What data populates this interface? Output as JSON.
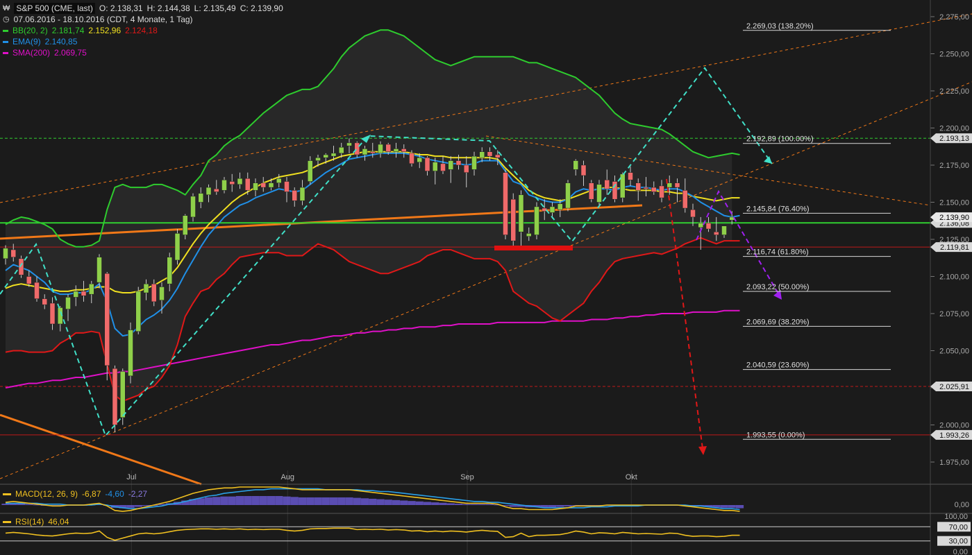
{
  "header": {
    "symbol": "S&P 500 (CME, last)",
    "open": "O: 2.138,31",
    "high": "H: 2.144,38",
    "low": "L: 2.135,49",
    "close": "C: 2.139,90",
    "range": "07.06.2016 - 18.10.2016 (CDT, 4 Monate, 1 Tag)"
  },
  "indicators": {
    "bb": {
      "label": "BB(20, 2)",
      "v1": "2.181,74",
      "v2": "2.152,96",
      "v3": "2.124,18"
    },
    "ema": {
      "label": "EMA(9)",
      "v": "2.140,85"
    },
    "sma": {
      "label": "SMA(200)",
      "v": "2.069,75"
    },
    "macd": {
      "label": "MACD(12, 26, 9)",
      "v1": "-6,87",
      "v2": "-4,60",
      "v3": "-2,27"
    },
    "rsi": {
      "label": "RSI(14)",
      "v": "46,04"
    }
  },
  "colors": {
    "background": "#1b1b1b",
    "bb_upper": "#2ecc2e",
    "bb_mid": "#f0e020",
    "bb_lower": "#e01818",
    "ema": "#2090e8",
    "sma": "#e010c8",
    "candle_up": "#8fd04a",
    "candle_down": "#f06a6a",
    "trend_orange": "#f07818",
    "zigzag_cyan": "#40e0c8",
    "arrow_purple": "#a020f0",
    "arrow_red": "#e01818"
  },
  "chart_data": {
    "type": "candlestick",
    "title": "S&P 500 (CME, last)",
    "ylim": [
      1955,
      2285
    ],
    "y_ticks": [
      "2.275,00",
      "2.250,00",
      "2.225,00",
      "2.200,00",
      "2.175,00",
      "2.150,00",
      "2.125,00",
      "2.100,00",
      "2.075,00",
      "2.050,00",
      "2.025,00",
      "2.000,00",
      "1.975,00"
    ],
    "x_labels": [
      {
        "label": "Jul",
        "index": 17
      },
      {
        "label": "Aug",
        "index": 37
      },
      {
        "label": "Sep",
        "index": 60
      },
      {
        "label": "Okt",
        "index": 81
      }
    ],
    "candles": [
      [
        2112,
        2121,
        2108,
        2119
      ],
      [
        2118,
        2122,
        2110,
        2113
      ],
      [
        2112,
        2114,
        2099,
        2101
      ],
      [
        2100,
        2104,
        2093,
        2095
      ],
      [
        2096,
        2100,
        2083,
        2085
      ],
      [
        2085,
        2088,
        2078,
        2081
      ],
      [
        2082,
        2086,
        2064,
        2068
      ],
      [
        2068,
        2080,
        2063,
        2079
      ],
      [
        2078,
        2088,
        2070,
        2086
      ],
      [
        2086,
        2094,
        2080,
        2090
      ],
      [
        2090,
        2097,
        2083,
        2087
      ],
      [
        2088,
        2097,
        2082,
        2095
      ],
      [
        2096,
        2115,
        2092,
        2113
      ],
      [
        2102,
        2103,
        2030,
        2040
      ],
      [
        2038,
        2040,
        1995,
        2000
      ],
      [
        2005,
        2038,
        2000,
        2036
      ],
      [
        2033,
        2069,
        2028,
        2064
      ],
      [
        2063,
        2093,
        2061,
        2090
      ],
      [
        2089,
        2098,
        2084,
        2095
      ],
      [
        2095,
        2098,
        2080,
        2083
      ],
      [
        2084,
        2096,
        2075,
        2093
      ],
      [
        2095,
        2116,
        2090,
        2113
      ],
      [
        2111,
        2132,
        2108,
        2129
      ],
      [
        2128,
        2142,
        2125,
        2141
      ],
      [
        2140,
        2156,
        2137,
        2154
      ],
      [
        2150,
        2160,
        2146,
        2156
      ],
      [
        2155,
        2162,
        2150,
        2160
      ],
      [
        2159,
        2165,
        2155,
        2157
      ],
      [
        2158,
        2167,
        2156,
        2165
      ],
      [
        2164,
        2169,
        2157,
        2162
      ],
      [
        2162,
        2170,
        2159,
        2166
      ],
      [
        2166,
        2170,
        2155,
        2158
      ],
      [
        2158,
        2166,
        2154,
        2163
      ],
      [
        2163,
        2167,
        2157,
        2160
      ],
      [
        2160,
        2166,
        2158,
        2163
      ],
      [
        2163,
        2169,
        2160,
        2166
      ],
      [
        2164,
        2167,
        2150,
        2157
      ],
      [
        2158,
        2160,
        2147,
        2151
      ],
      [
        2151,
        2165,
        2148,
        2160
      ],
      [
        2164,
        2181,
        2162,
        2178
      ],
      [
        2178,
        2182,
        2174,
        2180
      ],
      [
        2180,
        2183,
        2176,
        2182
      ],
      [
        2181,
        2188,
        2178,
        2183
      ],
      [
        2183,
        2190,
        2180,
        2187
      ],
      [
        2188,
        2193,
        2183,
        2190
      ],
      [
        2190,
        2191,
        2180,
        2182
      ],
      [
        2182,
        2188,
        2178,
        2186
      ],
      [
        2184,
        2190,
        2180,
        2183
      ],
      [
        2183,
        2191,
        2180,
        2189
      ],
      [
        2189,
        2190,
        2182,
        2184
      ],
      [
        2184,
        2190,
        2180,
        2186
      ],
      [
        2186,
        2189,
        2180,
        2184
      ],
      [
        2183,
        2185,
        2174,
        2176
      ],
      [
        2177,
        2183,
        2173,
        2180
      ],
      [
        2180,
        2181,
        2168,
        2171
      ],
      [
        2171,
        2180,
        2162,
        2177
      ],
      [
        2176,
        2181,
        2169,
        2171
      ],
      [
        2172,
        2181,
        2163,
        2178
      ],
      [
        2178,
        2182,
        2172,
        2175
      ],
      [
        2175,
        2181,
        2160,
        2170
      ],
      [
        2172,
        2184,
        2168,
        2181
      ],
      [
        2180,
        2187,
        2177,
        2184
      ],
      [
        2184,
        2187,
        2178,
        2181
      ],
      [
        2182,
        2185,
        2175,
        2180
      ],
      [
        2170,
        2172,
        2125,
        2128
      ],
      [
        2152,
        2156,
        2120,
        2124
      ],
      [
        2130,
        2158,
        2118,
        2155
      ],
      [
        2127,
        2133,
        2124,
        2129
      ],
      [
        2128,
        2150,
        2125,
        2147
      ],
      [
        2146,
        2152,
        2138,
        2144
      ],
      [
        2143,
        2150,
        2139,
        2147
      ],
      [
        2145,
        2152,
        2140,
        2149
      ],
      [
        2146,
        2165,
        2144,
        2163
      ],
      [
        2172,
        2179,
        2168,
        2178
      ],
      [
        2175,
        2178,
        2161,
        2168
      ],
      [
        2163,
        2165,
        2150,
        2152
      ],
      [
        2150,
        2165,
        2148,
        2162
      ],
      [
        2165,
        2172,
        2155,
        2159
      ],
      [
        2164,
        2168,
        2150,
        2152
      ],
      [
        2153,
        2170,
        2150,
        2169
      ],
      [
        2170,
        2174,
        2161,
        2165
      ],
      [
        2163,
        2166,
        2151,
        2158
      ],
      [
        2160,
        2167,
        2154,
        2159
      ],
      [
        2160,
        2164,
        2155,
        2157
      ],
      [
        2161,
        2165,
        2150,
        2153
      ],
      [
        2160,
        2168,
        2155,
        2163
      ],
      [
        2163,
        2166,
        2150,
        2160
      ],
      [
        2158,
        2166,
        2143,
        2146
      ],
      [
        2145,
        2149,
        2134,
        2140
      ],
      [
        2133,
        2140,
        2118,
        2136
      ],
      [
        2136,
        2140,
        2130,
        2132
      ],
      [
        2130,
        2140,
        2124,
        2128
      ],
      [
        2128,
        2133,
        2126,
        2134
      ],
      [
        2138,
        2144,
        2135,
        2140
      ]
    ],
    "bb_upper": [
      2135,
      2138,
      2140,
      2139,
      2137,
      2135,
      2132,
      2125,
      2122,
      2120,
      2120,
      2121,
      2124,
      2145,
      2160,
      2162,
      2160,
      2160,
      2160,
      2162,
      2162,
      2160,
      2158,
      2155,
      2162,
      2168,
      2178,
      2182,
      2188,
      2192,
      2195,
      2200,
      2205,
      2210,
      2214,
      2218,
      2222,
      2224,
      2226,
      2226,
      2228,
      2234,
      2240,
      2248,
      2254,
      2258,
      2262,
      2264,
      2266,
      2266,
      2264,
      2262,
      2258,
      2254,
      2250,
      2246,
      2244,
      2242,
      2244,
      2246,
      2248,
      2248,
      2248,
      2248,
      2248,
      2248,
      2246,
      2244,
      2244,
      2242,
      2240,
      2238,
      2236,
      2234,
      2230,
      2226,
      2222,
      2216,
      2210,
      2206,
      2203,
      2202,
      2201,
      2200,
      2199,
      2196,
      2192,
      2188,
      2184,
      2182,
      2180,
      2181,
      2182,
      2183,
      2182
    ],
    "bb_mid": [
      2092,
      2094,
      2095,
      2094,
      2093,
      2092,
      2091,
      2090,
      2090,
      2091,
      2091,
      2092,
      2093,
      2093,
      2090,
      2089,
      2089,
      2090,
      2092,
      2094,
      2097,
      2100,
      2106,
      2114,
      2122,
      2129,
      2135,
      2140,
      2145,
      2150,
      2154,
      2157,
      2160,
      2163,
      2165,
      2167,
      2168,
      2169,
      2170,
      2172,
      2175,
      2177,
      2179,
      2181,
      2182,
      2183,
      2184,
      2184,
      2184,
      2184,
      2184,
      2184,
      2183,
      2182,
      2182,
      2181,
      2181,
      2180,
      2180,
      2180,
      2180,
      2180,
      2180,
      2179,
      2173,
      2168,
      2163,
      2158,
      2155,
      2153,
      2152,
      2151,
      2152,
      2154,
      2156,
      2158,
      2159,
      2160,
      2160,
      2159,
      2158,
      2158,
      2158,
      2158,
      2157,
      2157,
      2156,
      2156,
      2154,
      2153,
      2152,
      2151,
      2152,
      2153,
      2153
    ],
    "bb_lower": [
      2049,
      2050,
      2050,
      2049,
      2049,
      2049,
      2050,
      2055,
      2058,
      2062,
      2062,
      2063,
      2062,
      2041,
      2020,
      2016,
      2018,
      2020,
      2024,
      2026,
      2032,
      2040,
      2054,
      2073,
      2082,
      2090,
      2092,
      2098,
      2102,
      2108,
      2113,
      2114,
      2115,
      2116,
      2116,
      2116,
      2114,
      2114,
      2114,
      2118,
      2122,
      2120,
      2118,
      2114,
      2110,
      2108,
      2106,
      2104,
      2102,
      2102,
      2104,
      2106,
      2108,
      2110,
      2114,
      2116,
      2118,
      2118,
      2116,
      2114,
      2112,
      2112,
      2112,
      2110,
      2104,
      2090,
      2086,
      2082,
      2080,
      2076,
      2072,
      2070,
      2074,
      2078,
      2082,
      2090,
      2096,
      2104,
      2110,
      2112,
      2113,
      2114,
      2115,
      2116,
      2115,
      2117,
      2119,
      2122,
      2124,
      2126,
      2124,
      2122,
      2124,
      2124,
      2124
    ],
    "ema": [
      2104,
      2108,
      2106,
      2104,
      2100,
      2096,
      2090,
      2088,
      2088,
      2089,
      2089,
      2091,
      2095,
      2083,
      2065,
      2060,
      2061,
      2066,
      2071,
      2074,
      2078,
      2084,
      2092,
      2102,
      2111,
      2120,
      2128,
      2134,
      2140,
      2144,
      2148,
      2150,
      2153,
      2155,
      2157,
      2159,
      2158,
      2157,
      2158,
      2162,
      2166,
      2170,
      2173,
      2176,
      2179,
      2180,
      2181,
      2182,
      2183,
      2183,
      2183,
      2183,
      2182,
      2181,
      2179,
      2178,
      2177,
      2176,
      2176,
      2175,
      2176,
      2178,
      2178,
      2178,
      2171,
      2164,
      2162,
      2155,
      2153,
      2151,
      2150,
      2150,
      2152,
      2157,
      2159,
      2158,
      2159,
      2159,
      2158,
      2160,
      2161,
      2160,
      2160,
      2159,
      2158,
      2159,
      2159,
      2157,
      2154,
      2150,
      2147,
      2144,
      2141,
      2140,
      2141
    ],
    "sma": [
      2025,
      2026,
      2027,
      2028,
      2028,
      2029,
      2030,
      2030,
      2031,
      2032,
      2032,
      2033,
      2034,
      2035,
      2035,
      2036,
      2036,
      2037,
      2038,
      2039,
      2040,
      2041,
      2042,
      2043,
      2044,
      2045,
      2046,
      2047,
      2048,
      2049,
      2050,
      2051,
      2052,
      2053,
      2054,
      2054,
      2055,
      2056,
      2057,
      2057,
      2058,
      2059,
      2060,
      2060,
      2061,
      2062,
      2062,
      2063,
      2063,
      2064,
      2064,
      2065,
      2065,
      2066,
      2066,
      2066,
      2067,
      2067,
      2068,
      2068,
      2068,
      2068,
      2068,
      2069,
      2069,
      2069,
      2069,
      2069,
      2069,
      2069,
      2070,
      2070,
      2070,
      2070,
      2070,
      2071,
      2071,
      2071,
      2072,
      2072,
      2073,
      2073,
      2074,
      2074,
      2075,
      2075,
      2075,
      2075,
      2076,
      2076,
      2076,
      2076,
      2077,
      2077,
      2077
    ],
    "fib_levels": [
      {
        "value": 2269.03,
        "label": "2.269,03 (138.20%)"
      },
      {
        "value": 2192.89,
        "label": "2.192,89 (100.00%)"
      },
      {
        "value": 2145.84,
        "label": "2.145,84 (76.40%)"
      },
      {
        "value": 2116.74,
        "label": "2.116,74 (61.80%)"
      },
      {
        "value": 2093.22,
        "label": "2.093,22 (50.00%)"
      },
      {
        "value": 2069.69,
        "label": "2.069,69 (38.20%)"
      },
      {
        "value": 2040.59,
        "label": "2.040,59 (23.60%)"
      },
      {
        "value": 1993.55,
        "label": "1.993,55 (0.00%)"
      }
    ],
    "hlines": [
      {
        "value": 2193.13,
        "label": "2.193,13",
        "color": "#30d030",
        "style": "dashed"
      },
      {
        "value": 2136.08,
        "label": "2.136,08",
        "color": "#30d030",
        "style": "solid"
      },
      {
        "value": 2119.81,
        "label": "2.119,81",
        "color": "#c01818",
        "style": "solid"
      },
      {
        "value": 2025.91,
        "label": "2.025,91",
        "color": "#c01818",
        "style": "dashed"
      },
      {
        "value": 1993.26,
        "label": "1.993,26",
        "color": "#c01818",
        "style": "solid"
      }
    ],
    "last_price": {
      "value": 2139.9,
      "label": "2.139,90"
    },
    "macd_ticks": [
      "0,00"
    ],
    "rsi_ticks": [
      "100,00",
      "70,00",
      "30,00",
      "0,00"
    ],
    "rsi_badges": [
      "70,00",
      "30,00"
    ],
    "rsi": [
      52,
      54,
      52,
      50,
      47,
      45,
      44,
      47,
      50,
      52,
      51,
      52,
      58,
      40,
      32,
      38,
      44,
      50,
      52,
      50,
      52,
      56,
      60,
      62,
      63,
      64,
      64,
      63,
      64,
      63,
      64,
      62,
      63,
      62,
      63,
      63,
      60,
      58,
      60,
      64,
      65,
      65,
      66,
      66,
      66,
      62,
      63,
      62,
      63,
      61,
      62,
      61,
      58,
      59,
      56,
      58,
      56,
      58,
      57,
      55,
      58,
      60,
      58,
      57,
      40,
      42,
      52,
      42,
      46,
      46,
      47,
      48,
      52,
      58,
      55,
      50,
      53,
      52,
      50,
      54,
      52,
      50,
      51,
      50,
      49,
      52,
      51,
      46,
      43,
      44,
      44,
      42,
      43,
      46,
      46
    ],
    "macd_line": [
      3,
      4,
      3,
      2,
      1,
      0,
      -1,
      -1,
      0,
      0,
      0,
      1,
      2,
      -1,
      -6,
      -7,
      -6,
      -4,
      -2,
      0,
      2,
      4,
      7,
      10,
      13,
      15,
      17,
      18,
      19,
      19,
      20,
      20,
      20,
      20,
      20,
      20,
      19,
      18,
      17,
      17,
      17,
      17,
      17,
      17,
      17,
      16,
      15,
      14,
      13,
      12,
      11,
      10,
      9,
      8,
      7,
      6,
      5,
      4,
      3,
      2,
      2,
      2,
      2,
      1,
      -2,
      -4,
      -4,
      -5,
      -5,
      -5,
      -5,
      -4,
      -3,
      -1,
      -1,
      -1,
      -1,
      0,
      0,
      0,
      0,
      0,
      0,
      0,
      0,
      0,
      0,
      -1,
      -2,
      -3,
      -4,
      -5,
      -6,
      -6,
      -7
    ],
    "macd_signal": [
      2,
      2,
      2,
      2,
      2,
      1,
      1,
      1,
      0,
      0,
      0,
      0,
      1,
      0,
      -2,
      -3,
      -4,
      -4,
      -3,
      -2,
      -1,
      1,
      2,
      4,
      6,
      8,
      10,
      11,
      13,
      14,
      15,
      16,
      17,
      17,
      18,
      18,
      18,
      18,
      18,
      18,
      18,
      17,
      17,
      17,
      17,
      17,
      16,
      16,
      15,
      15,
      14,
      13,
      12,
      11,
      10,
      9,
      8,
      7,
      6,
      5,
      4,
      4,
      3,
      3,
      2,
      1,
      0,
      -1,
      -2,
      -3,
      -3,
      -3,
      -3,
      -3,
      -3,
      -2,
      -2,
      -2,
      -1,
      -1,
      -1,
      -1,
      0,
      0,
      0,
      0,
      0,
      0,
      -1,
      -1,
      -2,
      -3,
      -4,
      -4,
      -5
    ]
  }
}
